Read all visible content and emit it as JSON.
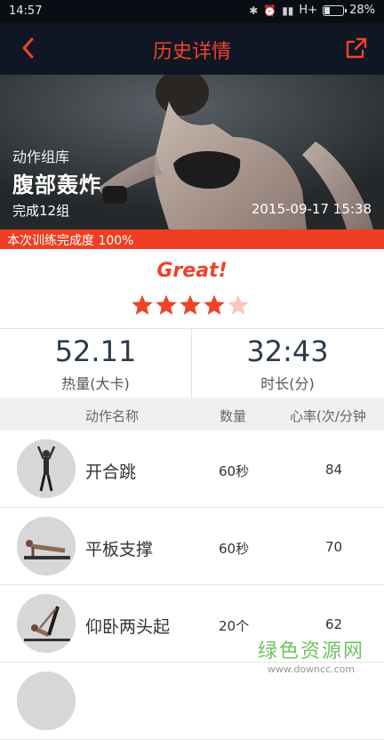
{
  "status_bar": {
    "time": "14:57",
    "network": "H+",
    "battery_percent": "28%",
    "battery_level": 0.28
  },
  "header": {
    "title": "历史详情",
    "back_icon": "chevron-left-icon",
    "share_icon": "share-icon",
    "accent_color": "#f0432a"
  },
  "hero": {
    "library_label": "动作组库",
    "workout_name": "腹部轰炸",
    "groups_done": "完成12组",
    "datetime": "2015-09-17 15:38"
  },
  "completion": {
    "label": "本次训练完成度 100%",
    "value": 1.0
  },
  "rating": {
    "text": "Great!",
    "stars": 4,
    "max_stars": 5
  },
  "stats": {
    "calories_value": "52.11",
    "calories_label": "热量(大卡)",
    "duration_value": "32:43",
    "duration_label": "时长(分)"
  },
  "table": {
    "headers": [
      "动作名称",
      "数量",
      "心率(次/分钟"
    ],
    "rows": [
      {
        "name": "开合跳",
        "qty": "60秒",
        "hr": "84"
      },
      {
        "name": "平板支撑",
        "qty": "60秒",
        "hr": "70"
      },
      {
        "name": "仰卧两头起",
        "qty": "20个",
        "hr": "62"
      },
      {
        "name": "",
        "qty": "",
        "hr": ""
      }
    ]
  },
  "watermark": {
    "brand": "绿色资源网",
    "url": "www.downcc.com"
  }
}
